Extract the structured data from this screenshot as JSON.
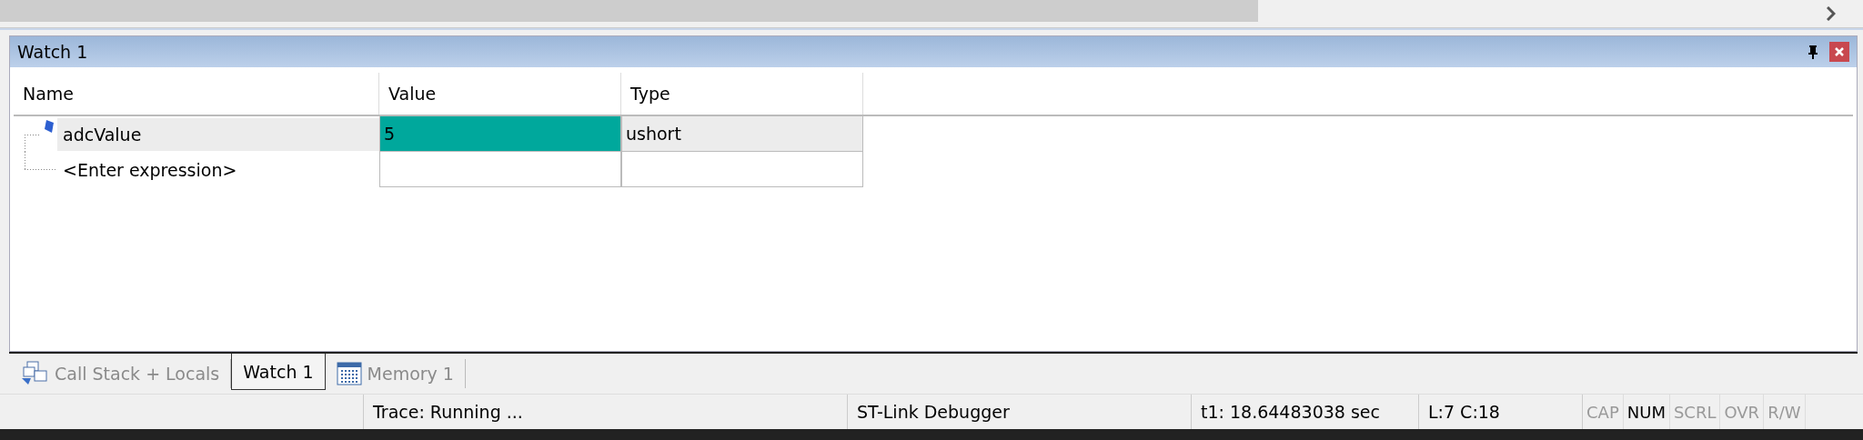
{
  "panel": {
    "title": "Watch 1"
  },
  "table": {
    "columns": [
      "Name",
      "Value",
      "Type"
    ],
    "rows": [
      {
        "name": "adcValue",
        "value": "5",
        "type": "ushort",
        "selected": true,
        "changed": true,
        "kind": "variable"
      },
      {
        "name": "<Enter expression>",
        "selected": false,
        "changed": false,
        "kind": "placeholder"
      }
    ]
  },
  "tabs": [
    {
      "label": "Call Stack + Locals",
      "kind": "stack",
      "selected": false
    },
    {
      "label": "Watch 1",
      "kind": "watch",
      "selected": true
    },
    {
      "label": "Memory 1",
      "kind": "memory",
      "selected": false
    }
  ],
  "status_bar": {
    "trace": "Trace: Running ...",
    "debugger": "ST-Link Debugger",
    "time": "t1: 18.64483038 sec",
    "position": "L:7 C:18",
    "indicators": [
      {
        "label": "CAP",
        "on": false
      },
      {
        "label": "NUM",
        "on": true
      },
      {
        "label": "SCRL",
        "on": false
      },
      {
        "label": "OVR",
        "on": false
      },
      {
        "label": "R/W",
        "on": false
      }
    ]
  }
}
